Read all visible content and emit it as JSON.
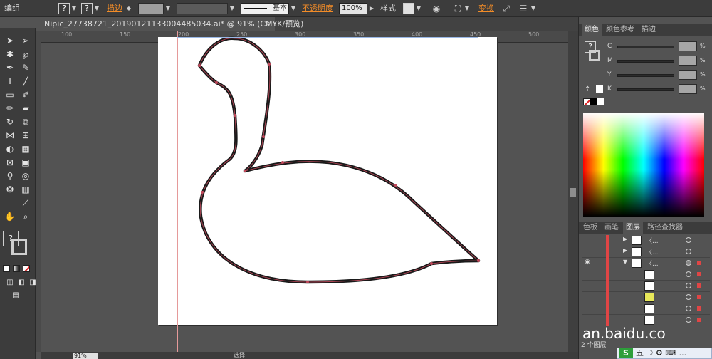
{
  "control_bar": {
    "mode_label": "编组",
    "stroke_label": "描边",
    "stroke_profile": "基本",
    "opacity_label": "不透明度",
    "opacity_value": "100%",
    "style_label": "样式",
    "transform_label": "变换",
    "question_glyph": "?"
  },
  "document": {
    "tab_title": "Nipic_27738721_20190121133004485034.ai* @ 91% (CMYK/预览)",
    "close_glyph": "×"
  },
  "ruler": {
    "labels": [
      "100",
      "150",
      "200",
      "250",
      "300",
      "350",
      "400",
      "450",
      "500"
    ]
  },
  "color_panel": {
    "tabs": [
      "颜色",
      "颜色参考",
      "描边"
    ],
    "channels": [
      {
        "letter": "C",
        "unit": "%"
      },
      {
        "letter": "M",
        "unit": "%"
      },
      {
        "letter": "Y",
        "unit": "%"
      },
      {
        "letter": "K",
        "unit": "%"
      }
    ]
  },
  "layers_panel": {
    "tabs": [
      "色板",
      "画笔",
      "图层",
      "路径查找器"
    ],
    "row_label": "〈...",
    "layer_count": "2 个图层"
  },
  "status_bar": {
    "zoom": "91%",
    "selection": "选择"
  },
  "watermark": "an.baidu.co",
  "ime": {
    "logo": "S",
    "text": "五 ☽ ⚙ ⌨ ..."
  }
}
